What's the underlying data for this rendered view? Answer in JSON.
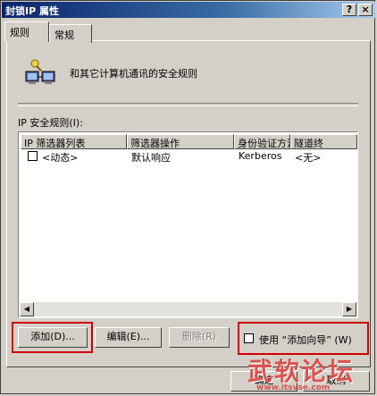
{
  "window": {
    "title": "封锁IP 属性",
    "help_label": "?",
    "close_label": "×"
  },
  "tabs": [
    {
      "label": "规则"
    },
    {
      "label": "常规"
    }
  ],
  "description": "和其它计算机通讯的安全规则",
  "rules_label": "IP 安全规则(I):",
  "table": {
    "columns": [
      "IP 筛选器列表",
      "筛选器操作",
      "身份验证方法",
      "隧道终"
    ],
    "rows": [
      {
        "checked": false,
        "cells": [
          "<动态>",
          "默认响应",
          "Kerberos",
          "<无>"
        ]
      }
    ]
  },
  "buttons": {
    "add": "添加(D)...",
    "edit": "编辑(E)...",
    "remove": "删除(R)"
  },
  "wizard_checkbox": {
    "label": "使用 “添加向导” (W)",
    "checked": false
  },
  "footer_buttons": {
    "ok": "确定",
    "cancel": "取消"
  },
  "watermark": {
    "brand": "武软论坛",
    "url": "www.itsvse.com"
  },
  "colors": {
    "highlight_box": "#d00000",
    "titlebar": "#0a246a",
    "watermark": "#d9534f"
  }
}
